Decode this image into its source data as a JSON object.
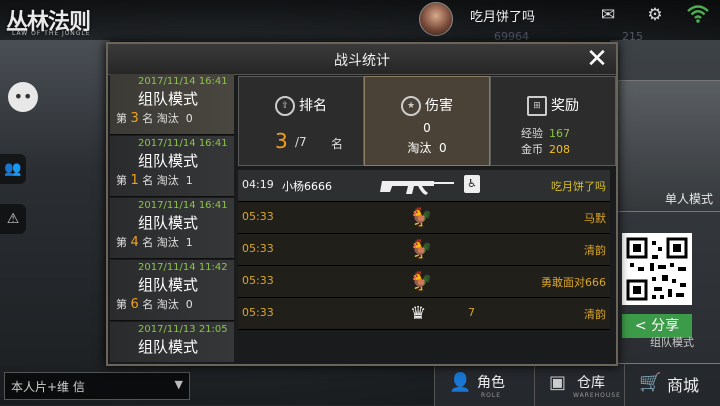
{
  "top_bar": {
    "logo": "丛林法则",
    "logo_sub": "LAW OF THE JUNGLE",
    "player_name": "吃月饼了吗",
    "icons": [
      "mail-icon",
      "gear-icon",
      "wifi-icon"
    ],
    "faded_currency": "69964",
    "faded_currency2": "215"
  },
  "modal": {
    "title": "战斗统计",
    "close_icon": "close-icon"
  },
  "matches": [
    {
      "time": "2017/11/14 16:41",
      "mode": "组队模式",
      "rank_prefix": "第 ",
      "rank": "3",
      "rank_suffix": " 名 淘汰  0"
    },
    {
      "time": "2017/11/14 16:41",
      "mode": "组队模式",
      "rank_prefix": "第 ",
      "rank": "1",
      "rank_suffix": " 名 淘汰  1"
    },
    {
      "time": "2017/11/14 16:41",
      "mode": "组队模式",
      "rank_prefix": "第 ",
      "rank": "4",
      "rank_suffix": " 名 淘汰  1"
    },
    {
      "time": "2017/11/14 11:42",
      "mode": "组队模式",
      "rank_prefix": "第 ",
      "rank": "6",
      "rank_suffix": " 名 淘汰  0"
    },
    {
      "time": "2017/11/13 21:05",
      "mode": "组队模式",
      "rank_prefix": "",
      "rank": "",
      "rank_suffix": ""
    }
  ],
  "tabs": {
    "ranking": {
      "label": "排名",
      "value": "3",
      "total": "/7",
      "unit": "名"
    },
    "damage": {
      "label": "伤害",
      "value": "0",
      "kills_label": "淘汰",
      "kills": "0"
    },
    "reward": {
      "label": "奖励",
      "exp_label": "经验",
      "exp": "167",
      "gold_label": "金币",
      "gold": "208"
    }
  },
  "feed": [
    {
      "time": "04:19",
      "killer": "小杨6666",
      "icon": "rifle-icon",
      "extra_icon": "knocked-icon",
      "count": "",
      "victim": "吃月饼了吗",
      "kind": "self"
    },
    {
      "time": "05:33",
      "killer": "",
      "icon": "chicken-icon",
      "count": "",
      "victim": "马默",
      "kind": "other"
    },
    {
      "time": "05:33",
      "killer": "",
      "icon": "chicken-icon",
      "count": "",
      "victim": "清韵",
      "kind": "other"
    },
    {
      "time": "05:33",
      "killer": "",
      "icon": "chicken-icon",
      "count": "",
      "victim": "勇敢面对666",
      "kind": "other"
    },
    {
      "time": "05:33",
      "killer": "",
      "icon": "crown-icon",
      "count": "7",
      "victim": "清韵",
      "kind": "other"
    }
  ],
  "right_panel": {
    "single_mode": "单人模式",
    "share": "分享",
    "team_mode": "组队模式"
  },
  "bottom": {
    "input_text": "本人片+维  信",
    "role": "角色",
    "role_sub": "ROLE",
    "warehouse": "仓库",
    "warehouse_sub": "WAREHOUSE",
    "shop": "商城"
  }
}
